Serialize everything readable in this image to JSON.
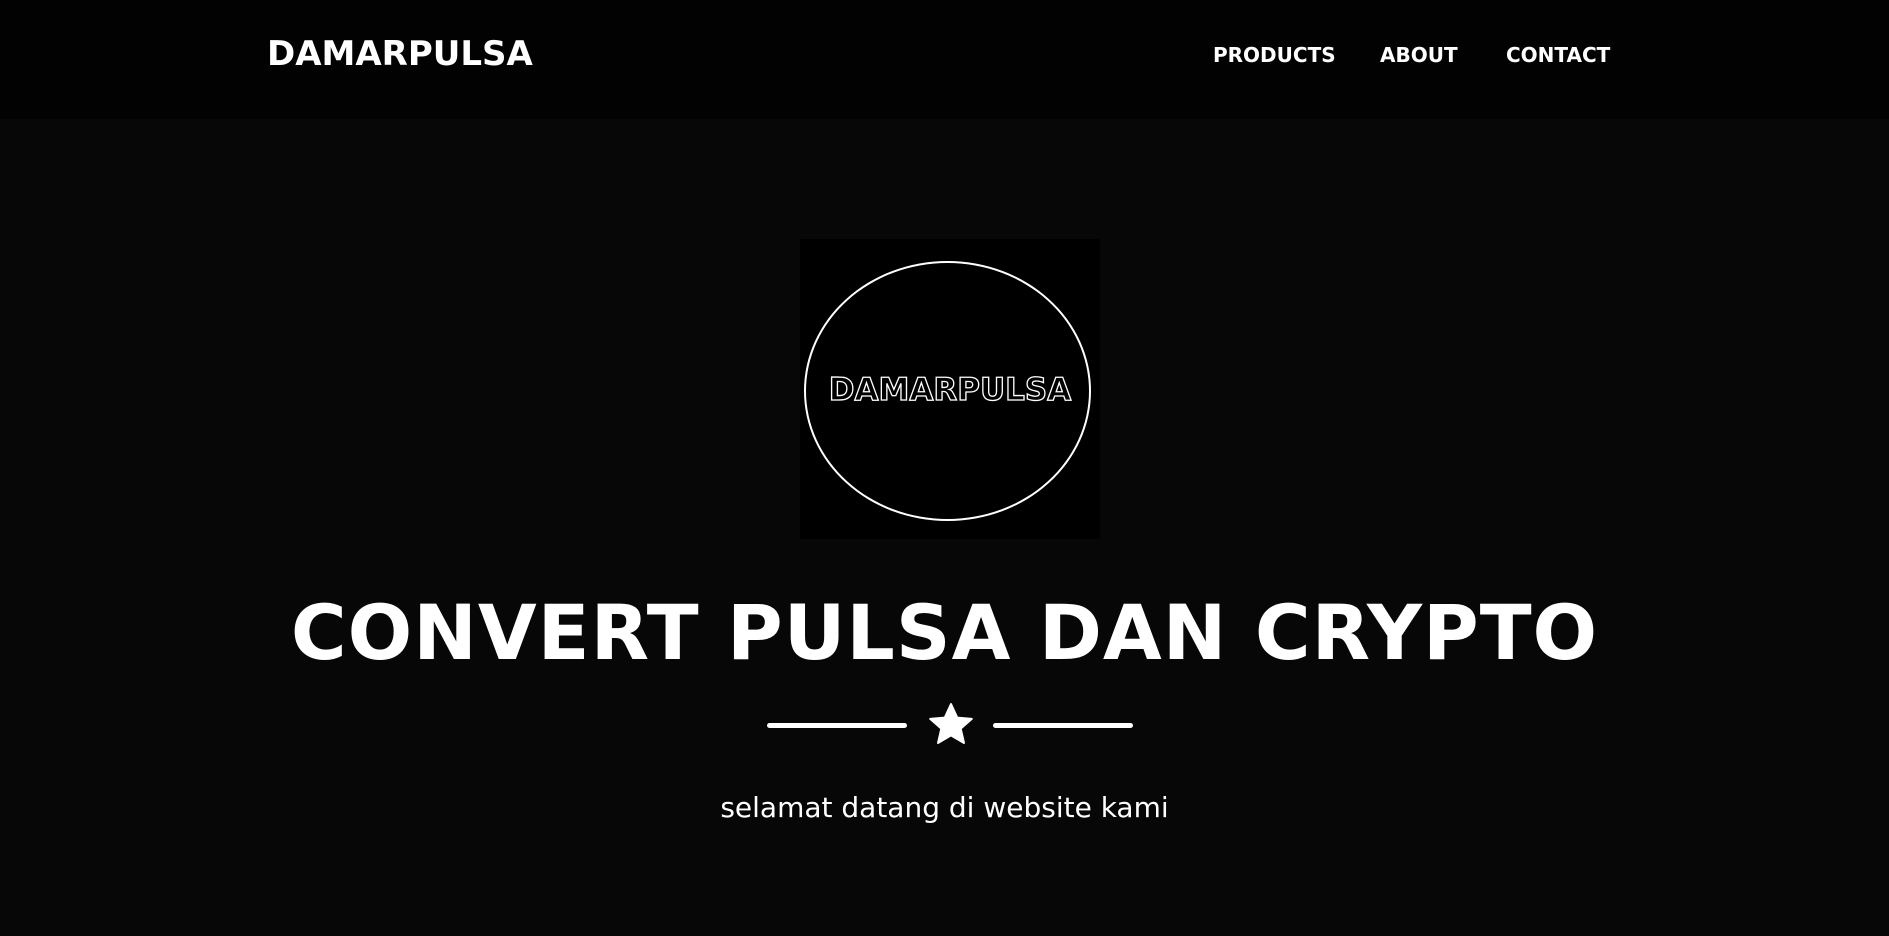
{
  "navbar": {
    "brand": "DAMARPULSA",
    "links": [
      {
        "label": "PRODUCTS"
      },
      {
        "label": "ABOUT"
      },
      {
        "label": "CONTACT"
      }
    ]
  },
  "hero": {
    "logo_text": "DAMARPULSA",
    "headline": "CONVERT PULSA DAN CRYPTO",
    "divider_icon": "star-icon",
    "subtitle": "selamat datang di website kami"
  },
  "colors": {
    "page_background": "#070707",
    "navbar_background": "#020202",
    "text": "#ffffff"
  }
}
